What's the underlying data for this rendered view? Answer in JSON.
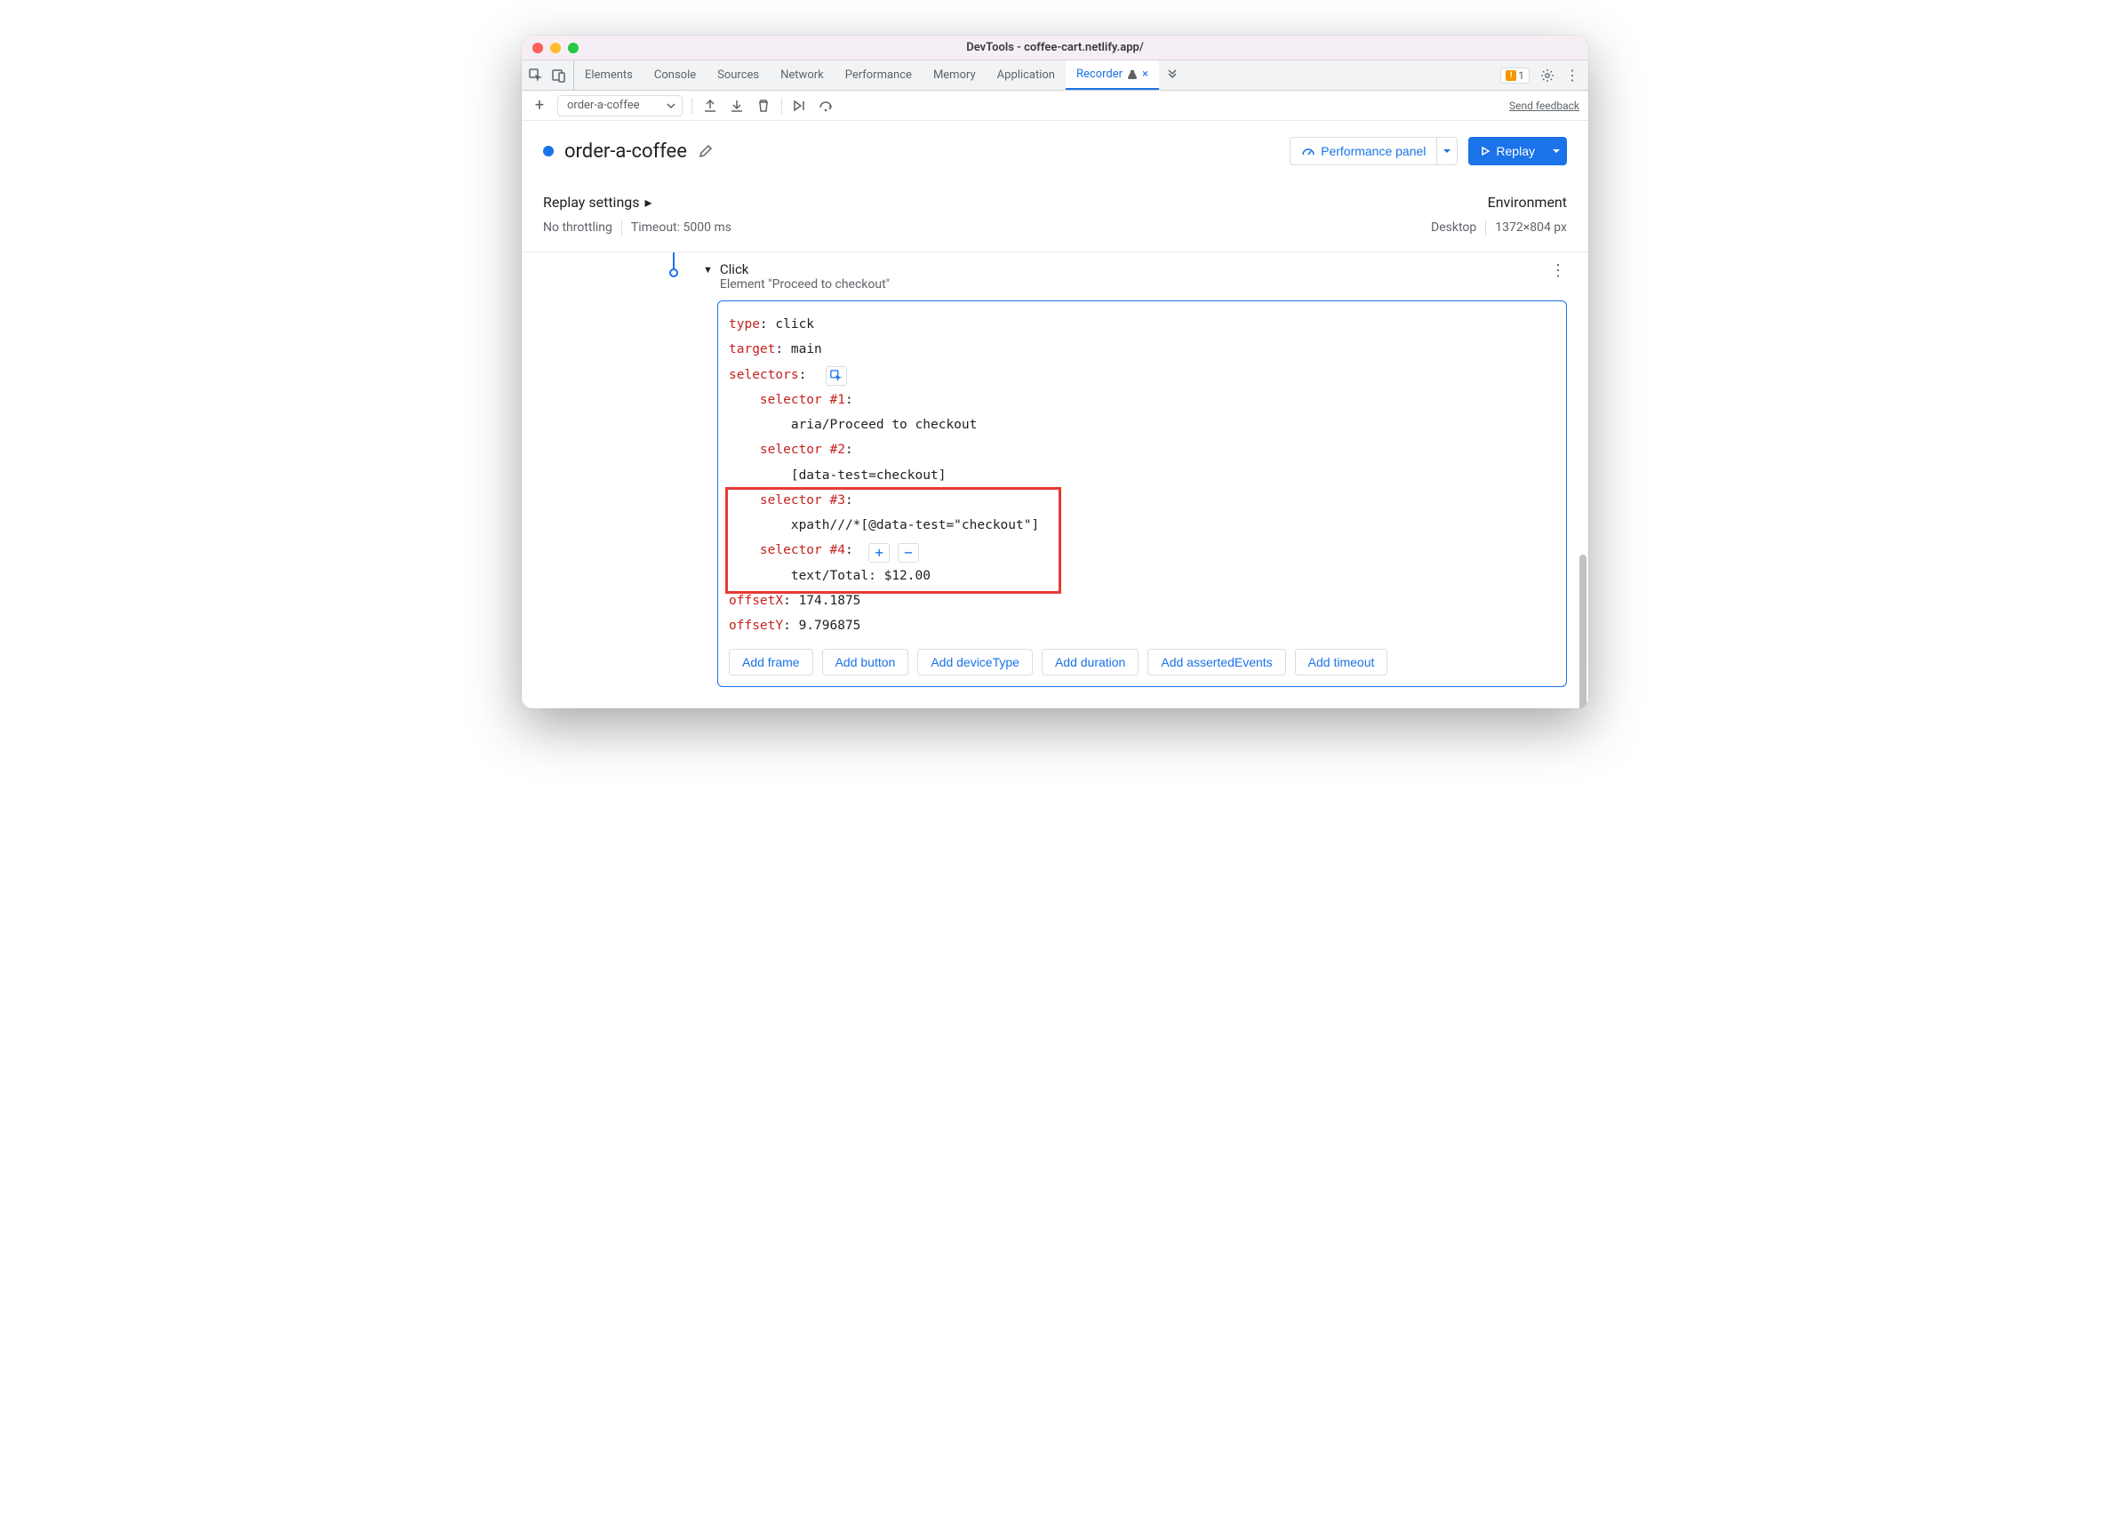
{
  "window": {
    "title": "DevTools - coffee-cart.netlify.app/"
  },
  "tabs": {
    "items": [
      "Elements",
      "Console",
      "Sources",
      "Network",
      "Performance",
      "Memory",
      "Application",
      "Recorder"
    ],
    "active_index": 7,
    "warning_count": "1"
  },
  "toolbar": {
    "recording_name": "order-a-coffee",
    "feedback": "Send feedback"
  },
  "header": {
    "title": "order-a-coffee",
    "perf_panel": "Performance panel",
    "replay": "Replay"
  },
  "settings": {
    "title": "Replay settings",
    "throttling": "No throttling",
    "timeout": "Timeout: 5000 ms",
    "env_title": "Environment",
    "device": "Desktop",
    "dimensions": "1372×804 px"
  },
  "step": {
    "title": "Click",
    "subtitle": "Element \"Proceed to checkout\"",
    "props": {
      "type_label": "type",
      "type_value": "click",
      "target_label": "target",
      "target_value": "main",
      "selectors_label": "selectors",
      "sel1_label": "selector #1",
      "sel1_value": "aria/Proceed to checkout",
      "sel2_label": "selector #2",
      "sel2_value": "[data-test=checkout]",
      "sel3_label": "selector #3",
      "sel3_value": "xpath///*[@data-test=\"checkout\"]",
      "sel4_label": "selector #4",
      "sel4_value": "text/Total: $12.00",
      "offx_label": "offsetX",
      "offx_value": "174.1875",
      "offy_label": "offsetY",
      "offy_value": "9.796875"
    },
    "add_buttons": [
      "Add frame",
      "Add button",
      "Add deviceType",
      "Add duration",
      "Add assertedEvents",
      "Add timeout"
    ]
  }
}
